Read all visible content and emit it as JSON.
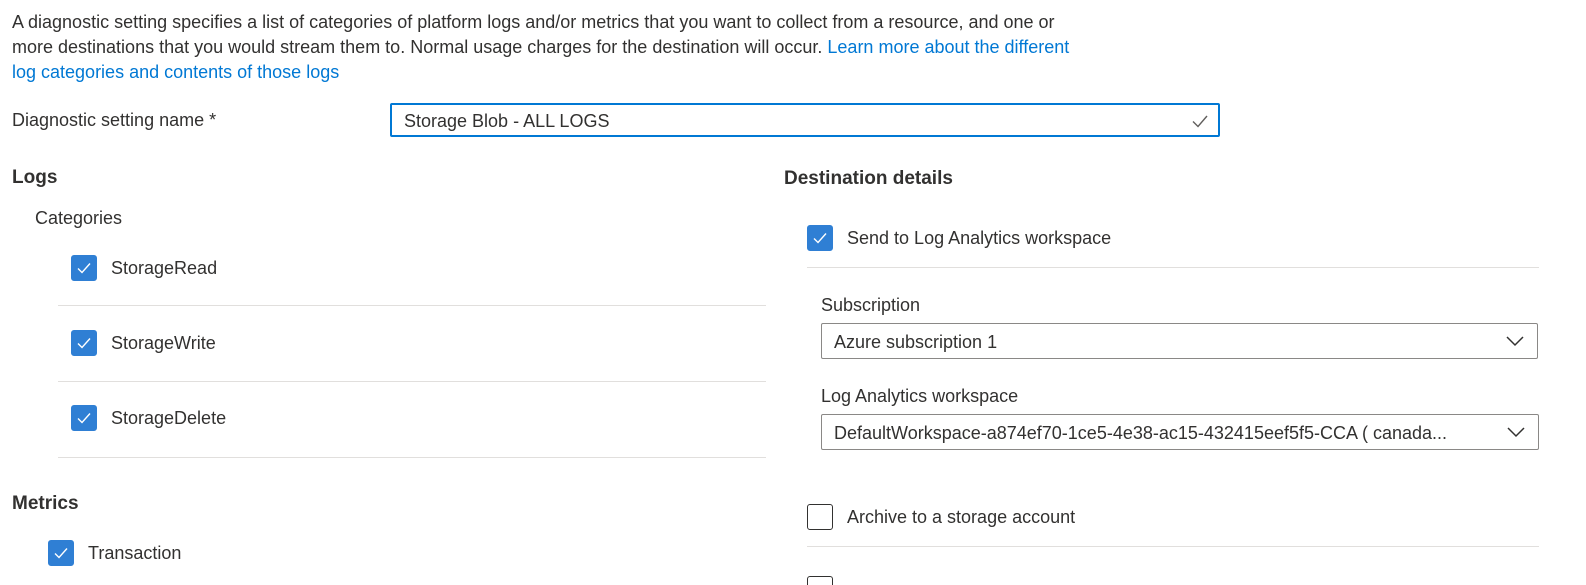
{
  "intro": {
    "text": "A diagnostic setting specifies a list of categories of platform logs and/or metrics that you want to collect from a resource, and one or more destinations that you would stream them to. Normal usage charges for the destination will occur. ",
    "link_text": "Learn more about the different log categories and contents of those logs"
  },
  "setting_name": {
    "label": "Diagnostic setting name *",
    "value": "Storage Blob - ALL LOGS",
    "valid": true
  },
  "logs": {
    "heading": "Logs",
    "categories_label": "Categories",
    "categories": [
      {
        "label": "StorageRead",
        "checked": true
      },
      {
        "label": "StorageWrite",
        "checked": true
      },
      {
        "label": "StorageDelete",
        "checked": true
      }
    ]
  },
  "metrics": {
    "heading": "Metrics",
    "items": [
      {
        "label": "Transaction",
        "checked": true
      }
    ]
  },
  "destination": {
    "heading": "Destination details",
    "log_analytics": {
      "label": "Send to Log Analytics workspace",
      "checked": true,
      "subscription_label": "Subscription",
      "subscription_value": "Azure subscription 1",
      "workspace_label": "Log Analytics workspace",
      "workspace_value": "DefaultWorkspace-a874ef70-1ce5-4e38-ac15-432415eef5f5-CCA ( canada..."
    },
    "archive": {
      "label": "Archive to a storage account",
      "checked": false
    }
  },
  "icons": {
    "checkmark": "checkmark-icon",
    "chevron": "chevron-down-icon"
  },
  "colors": {
    "accent": "#0078d4",
    "checkbox_fill": "#2f7fd4",
    "text": "#323130",
    "divider": "#e1dfdd"
  }
}
